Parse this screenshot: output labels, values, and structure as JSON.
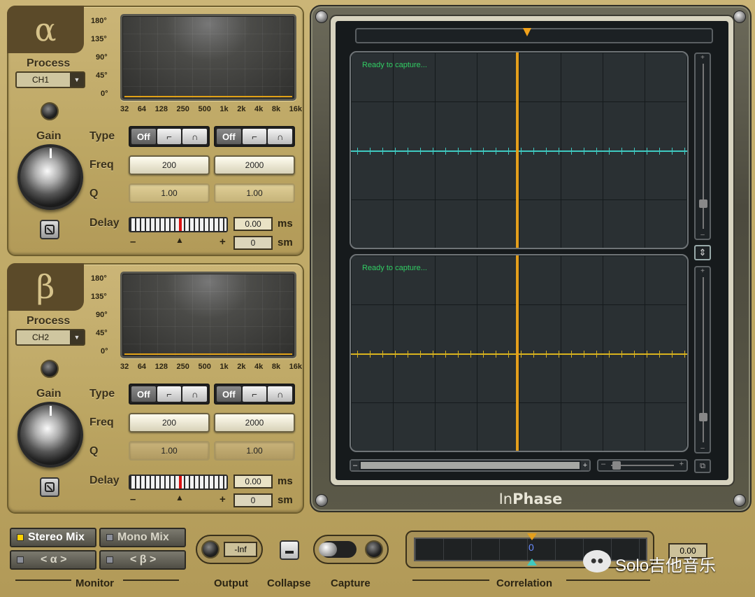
{
  "alpha": {
    "symbol": "α",
    "process_label": "Process",
    "channel": "CH1",
    "gain_label": "Gain",
    "type_label": "Type",
    "freq_label": "Freq",
    "q_label": "Q",
    "delay_label": "Delay",
    "type_off": "Off",
    "freq1": "200",
    "freq2": "2000",
    "q1": "1.00",
    "q2": "1.00",
    "delay_ms": "0.00",
    "delay_sm": "0",
    "unit_ms": "ms",
    "unit_sm": "sm",
    "minus": "–",
    "plus": "+"
  },
  "beta": {
    "symbol": "β",
    "process_label": "Process",
    "channel": "CH2",
    "gain_label": "Gain",
    "type_label": "Type",
    "freq_label": "Freq",
    "q_label": "Q",
    "delay_label": "Delay",
    "type_off": "Off",
    "freq1": "200",
    "freq2": "2000",
    "q1": "1.00",
    "q2": "1.00",
    "delay_ms": "0.00",
    "delay_sm": "0",
    "unit_ms": "ms",
    "unit_sm": "sm",
    "minus": "–",
    "plus": "+"
  },
  "phase_axis": [
    "180°",
    "135°",
    "90°",
    "45°",
    "0°"
  ],
  "freq_axis": [
    "32",
    "64",
    "128",
    "250",
    "500",
    "1k",
    "2k",
    "4k",
    "8k",
    "16k"
  ],
  "display": {
    "ready_top": "Ready to capture...",
    "ready_bottom": "Ready to capture...",
    "brand_in": "In",
    "brand_phase": "Phase"
  },
  "monitor": {
    "stereo": "Stereo Mix",
    "mono": "Mono Mix",
    "alpha": "< α >",
    "beta": "< β >",
    "section": "Monitor"
  },
  "output": {
    "value": "-Inf",
    "label": "Output"
  },
  "collapse": {
    "label": "Collapse"
  },
  "capture": {
    "label": "Capture"
  },
  "correlation": {
    "label": "Correlation",
    "value": "0.00",
    "center": "0"
  },
  "watermark": "Solo吉他音乐",
  "colors": {
    "accent": "#e49f1c",
    "scope_cyan": "#3fc9c0",
    "scope_yellow": "#d8b21e",
    "ready": "#31ce64"
  }
}
